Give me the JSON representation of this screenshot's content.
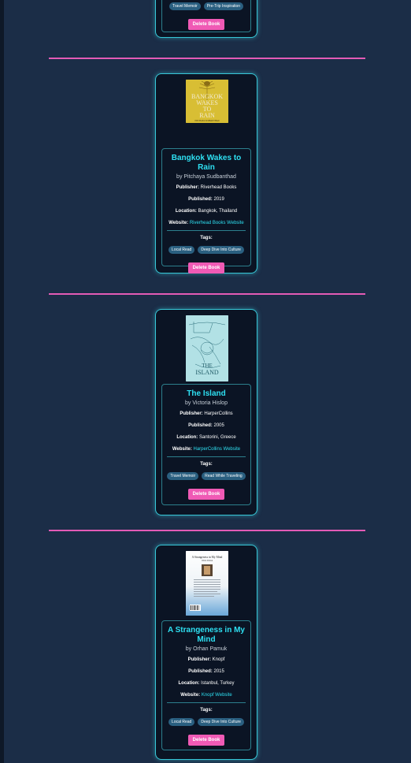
{
  "top_card": {
    "tags": [
      "Travel Memoir",
      "Pre-Trip Inspiration"
    ],
    "delete_label": "Delete Book"
  },
  "books": [
    {
      "title": "Bangkok Wakes to Rain",
      "author": "by Pitchaya Sudbanthad",
      "publisher_label": "Publisher:",
      "publisher": "Riverhead Books",
      "published_label": "Published:",
      "published": "2019",
      "location_label": "Location:",
      "location": "Bangkok, Thailand",
      "website_label": "Website:",
      "website": "Riverhead Books Website",
      "tags_label": "Tags:",
      "tags": [
        "Local Read",
        "Deep Dive Into Culture"
      ],
      "delete_label": "Delete Book",
      "cover_text": [
        "BANGKOK",
        "WAKES",
        "TO",
        "RAIN"
      ],
      "cover_author": "PITCHAYA SUDBANTHAD"
    },
    {
      "title": "The Island",
      "author": "by Victoria Hislop",
      "publisher_label": "Publisher:",
      "publisher": "HarperCollins",
      "published_label": "Published:",
      "published": "2005",
      "location_label": "Location:",
      "location": "Santorini, Greece",
      "website_label": "Website:",
      "website": "HarperCollins Website",
      "tags_label": "Tags:",
      "tags": [
        "Travel Memoir",
        "Read While Traveling"
      ],
      "delete_label": "Delete Book",
      "cover_text": [
        "THE",
        "ISLAND"
      ]
    },
    {
      "title": "A Strangeness in My Mind",
      "author": "by Orhan Pamuk",
      "publisher_label": "Publisher:",
      "publisher": "Knopf",
      "published_label": "Published:",
      "published": "2015",
      "location_label": "Location:",
      "location": "Istanbul, Turkey",
      "website_label": "Website:",
      "website": "Knopf Website",
      "tags_label": "Tags:",
      "tags": [
        "Local Read",
        "Deep Dive Into Culture"
      ],
      "delete_label": "Delete Book",
      "cover_text": [
        "A Strangeness in My Mind",
        "Orhan Pamuk"
      ]
    }
  ]
}
